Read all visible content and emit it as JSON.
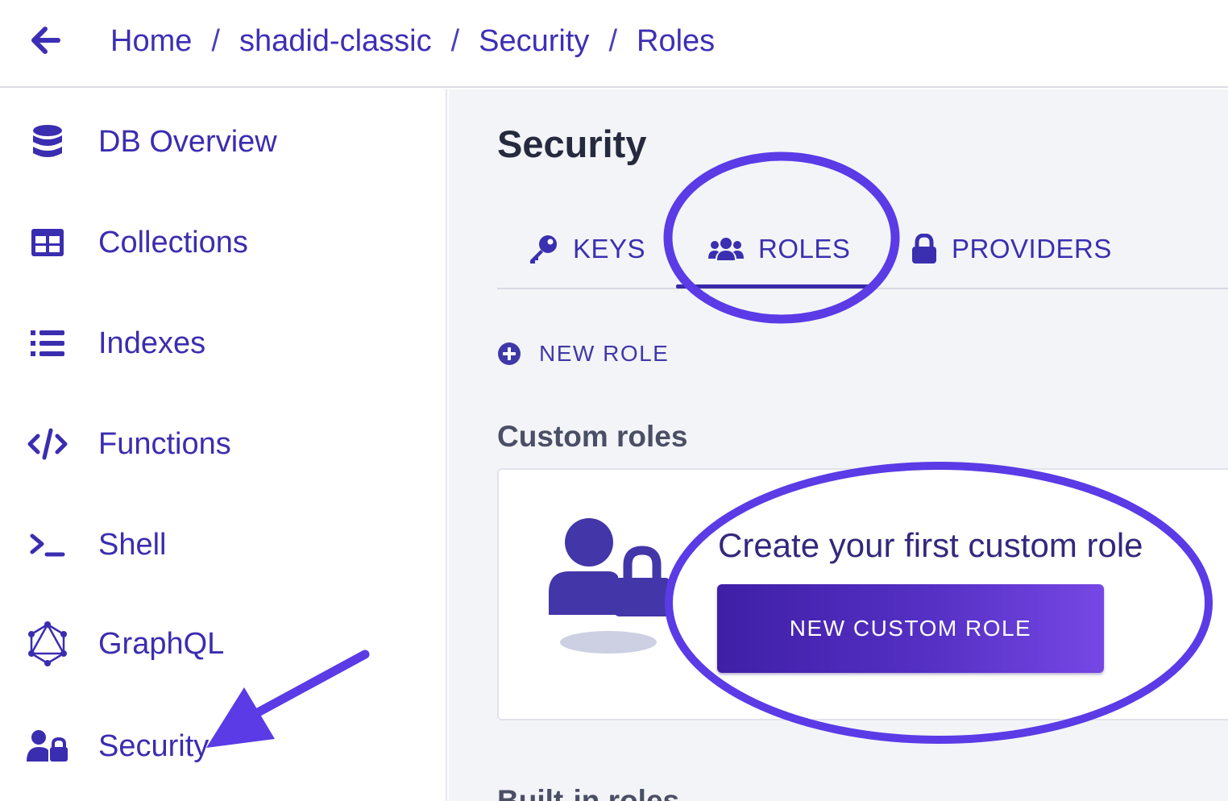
{
  "breadcrumb": {
    "items": [
      "Home",
      "shadid-classic",
      "Security",
      "Roles"
    ],
    "separator": "/"
  },
  "sidebar": {
    "items": [
      {
        "label": "DB Overview",
        "icon": "database-icon"
      },
      {
        "label": "Collections",
        "icon": "table-icon"
      },
      {
        "label": "Indexes",
        "icon": "list-icon"
      },
      {
        "label": "Functions",
        "icon": "code-icon"
      },
      {
        "label": "Shell",
        "icon": "terminal-icon"
      },
      {
        "label": "GraphQL",
        "icon": "graphql-icon"
      },
      {
        "label": "Security",
        "icon": "user-lock-icon"
      }
    ]
  },
  "main": {
    "title": "Security",
    "tabs": [
      {
        "label": "KEYS",
        "icon": "key-icon"
      },
      {
        "label": "ROLES",
        "icon": "users-icon",
        "active": true
      },
      {
        "label": "PROVIDERS",
        "icon": "lock-icon"
      }
    ],
    "new_role_label": "NEW ROLE",
    "custom_roles_title": "Custom roles",
    "empty_state": {
      "title": "Create your first custom role",
      "button_label": "NEW CUSTOM ROLE"
    },
    "builtin_roles_title": "Built-in roles"
  },
  "colors": {
    "accent": "#3d2fb5",
    "annotation": "#5a3be6",
    "main_bg": "#f3f4f8"
  }
}
